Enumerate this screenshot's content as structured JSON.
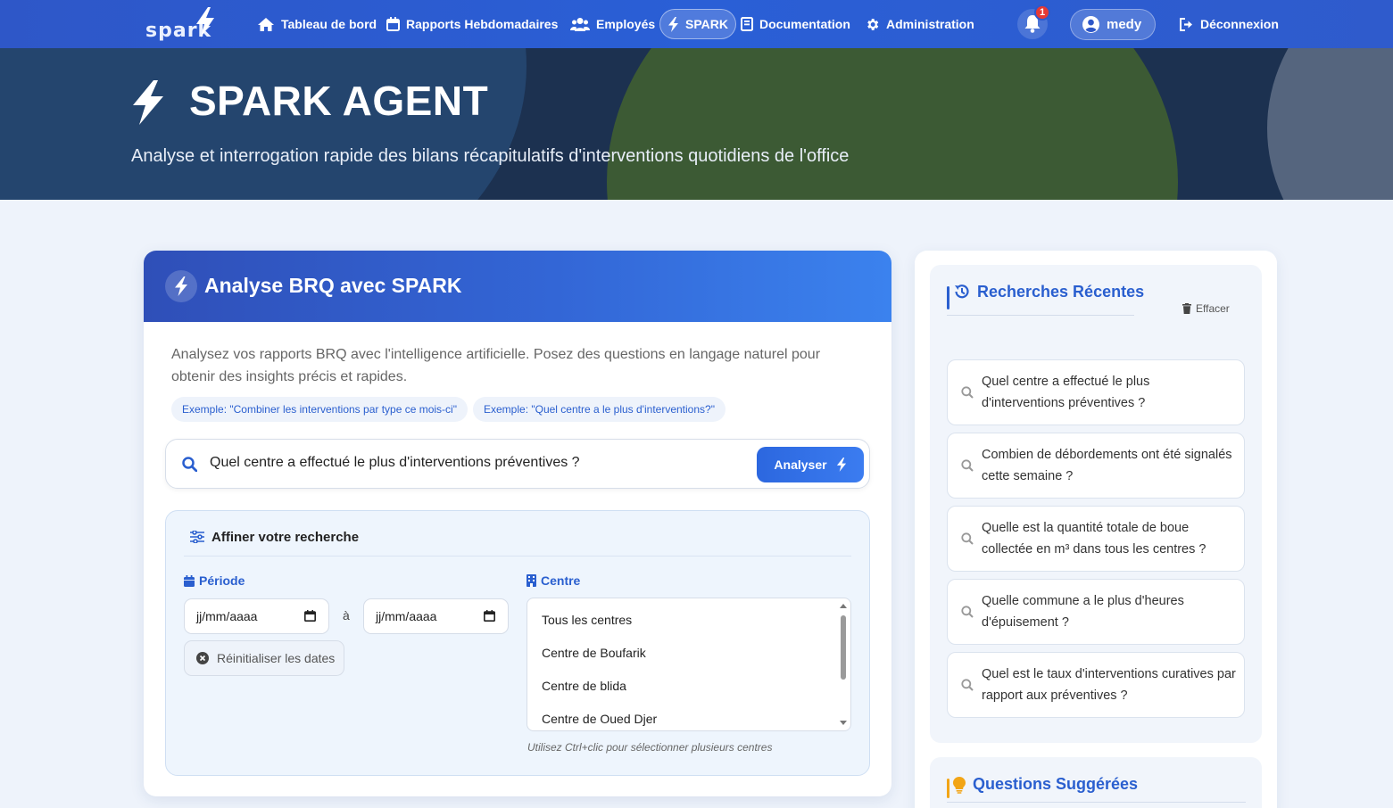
{
  "nav": {
    "logo_text": "spark",
    "items": [
      {
        "label": "Tableau de bord",
        "icon": "home-icon"
      },
      {
        "label": "Rapports Hebdomadaires",
        "icon": "calendar-icon"
      },
      {
        "label": "Employés",
        "icon": "users-icon"
      },
      {
        "label": "SPARK",
        "icon": "bolt-icon",
        "active": true
      },
      {
        "label": "Documentation",
        "icon": "book-icon"
      },
      {
        "label": "Administration",
        "icon": "gear-icon"
      }
    ],
    "notification_count": "1",
    "username": "medy",
    "logout_label": "Déconnexion"
  },
  "hero": {
    "title": "SPARK AGENT",
    "subtitle": "Analyse et interrogation rapide des bilans récapitulatifs d'interventions quotidiens de l'office"
  },
  "analysis": {
    "title": "Analyse BRQ avec SPARK",
    "description": "Analysez vos rapports BRQ avec l'intelligence artificielle. Posez des questions en langage naturel pour obtenir des insights précis et rapides.",
    "examples": [
      "Exemple: \"Combiner les interventions par type ce mois-ci\"",
      "Exemple: \"Quel centre a le plus d'interventions?\""
    ],
    "query": "Quel centre a effectué le plus d'interventions préventives ?",
    "analyze_label": "Analyser"
  },
  "refine": {
    "title": "Affiner votre recherche",
    "period_label": "Période",
    "date_from_placeholder": "jj/mm/aaaa",
    "date_separator": "à",
    "date_to_placeholder": "jj/mm/aaaa",
    "reset_label": "Réinitialiser les dates",
    "centre_label": "Centre",
    "centres": [
      "Tous les centres",
      "Centre de Boufarik",
      "Centre de blida",
      "Centre de Oued Djer"
    ],
    "hint": "Utilisez Ctrl+clic pour sélectionner plusieurs centres"
  },
  "recent": {
    "title": "Recherches Récentes",
    "clear_label": "Effacer",
    "items": [
      "Quel centre a effectué le plus d'interventions préventives ?",
      "Combien de débordements ont été signalés cette semaine ?",
      "Quelle est la quantité totale de boue collectée en m³ dans tous les centres ?",
      "Quelle commune a le plus d'heures d'épuisement ?",
      "Quel est le taux d'interventions curatives par rapport aux préventives ?"
    ]
  },
  "suggested": {
    "title": "Questions Suggérées"
  },
  "colors": {
    "primary": "#2a5fcf",
    "navbar": "#2e57c8",
    "accent_orange": "#f2a516",
    "badge_red": "#e53935"
  }
}
